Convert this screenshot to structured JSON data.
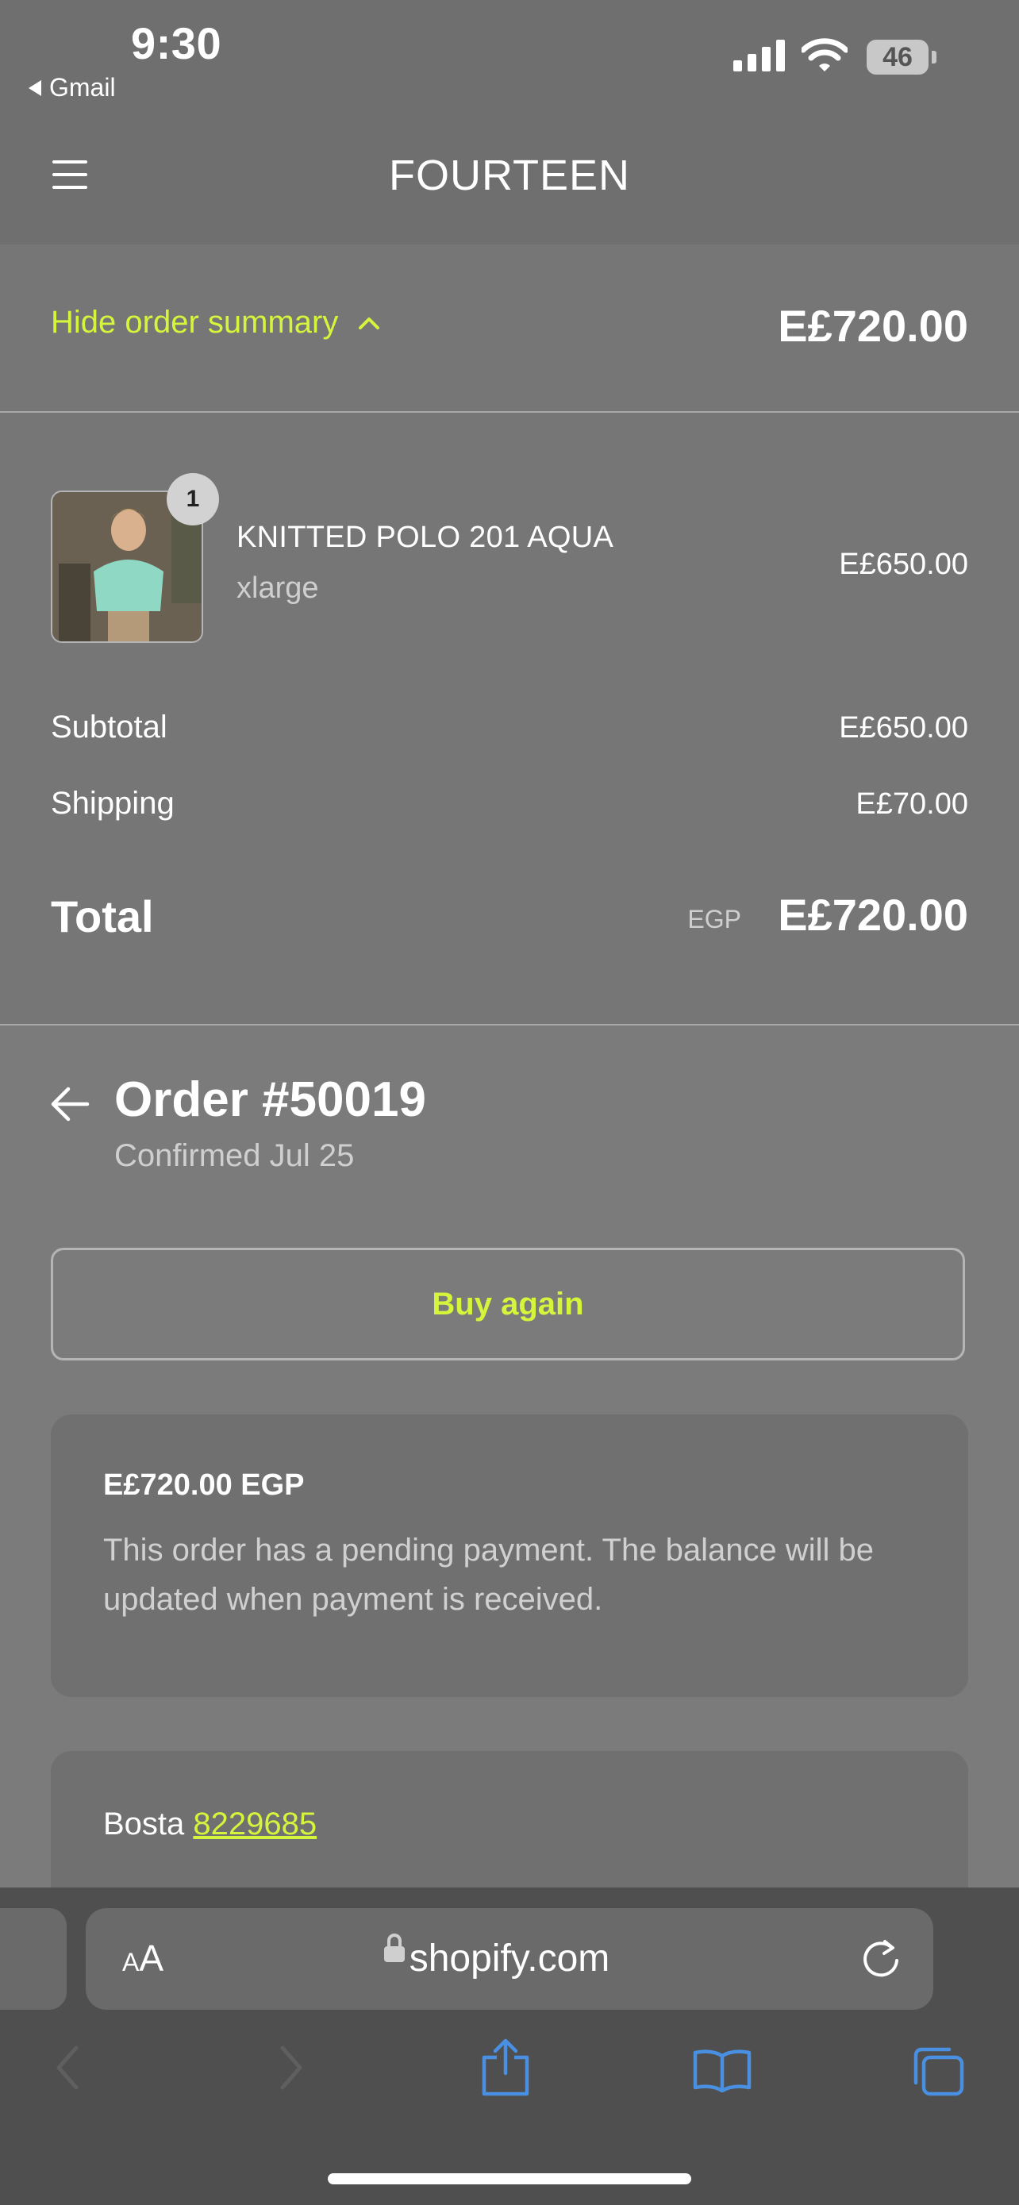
{
  "status_bar": {
    "time": "9:30",
    "back_app": "Gmail",
    "battery": "46"
  },
  "header": {
    "store_title": "FOURTEEN",
    "menu_icon": "hamburger-menu-icon"
  },
  "summary": {
    "toggle_label": "Hide order summary",
    "toggle_icon": "chevron-up-icon",
    "total_top": "E£720.00",
    "line_items": [
      {
        "quantity": "1",
        "name": "KNITTED POLO 201 AQUA",
        "variant": "xlarge",
        "price": "E£650.00"
      }
    ],
    "subtotal_label": "Subtotal",
    "subtotal_value": "E£650.00",
    "shipping_label": "Shipping",
    "shipping_value": "E£70.00",
    "total_label": "Total",
    "currency_code": "EGP",
    "total_value": "E£720.00"
  },
  "order": {
    "title": "Order #50019",
    "subtitle": "Confirmed Jul 25",
    "buy_again_label": "Buy again",
    "payment_amount": "E£720.00 EGP",
    "payment_message": "This order has a pending payment. The balance will be updated when payment is received.",
    "carrier": "Bosta",
    "tracking_number": "8229685"
  },
  "browser": {
    "aa_label_small": "A",
    "aa_label_large": "A",
    "url": "shopify.com"
  },
  "colors": {
    "accent": "#d4f53c",
    "background": "#7a7a7a",
    "browser_bar": "#4f4f4f",
    "toolbar_icon": "#4a90e2"
  }
}
